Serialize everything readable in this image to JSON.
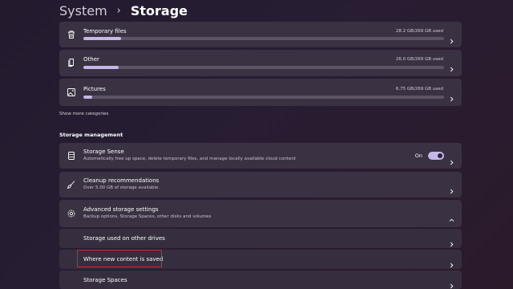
{
  "breadcrumb": {
    "parent": "System",
    "separator": "›",
    "current": "Storage"
  },
  "categories": [
    {
      "label": "Temporary files",
      "used": "28.2 GB/269 GB used",
      "fraction": 0.105,
      "icon": "trash-icon"
    },
    {
      "label": "Other",
      "used": "26.0 GB/269 GB used",
      "fraction": 0.097,
      "icon": "file-copy-icon"
    },
    {
      "label": "Pictures",
      "used": "6.75 GB/269 GB used",
      "fraction": 0.025,
      "icon": "image-icon"
    }
  ],
  "show_more_label": "Show more categories",
  "storage_management": {
    "heading": "Storage management",
    "storage_sense": {
      "title": "Storage Sense",
      "description": "Automatically free up space, delete temporary files, and manage locally available cloud content",
      "toggle_label": "On",
      "toggle_on": true,
      "icon": "drive-icon"
    },
    "cleanup": {
      "title": "Cleanup recommendations",
      "description": "Over 5.00 GB of storage available.",
      "icon": "broom-icon"
    },
    "advanced": {
      "title": "Advanced storage settings",
      "description": "Backup options, Storage Spaces, other disks and volumes",
      "icon": "gear-icon",
      "expanded": true,
      "items": [
        {
          "label": "Storage used on other drives"
        },
        {
          "label": "Where new content is saved",
          "highlighted": true
        },
        {
          "label": "Storage Spaces"
        }
      ]
    }
  },
  "colors": {
    "accent": "#c5b8e8",
    "highlight_box": "#e0202a",
    "card": "#3a3142"
  }
}
